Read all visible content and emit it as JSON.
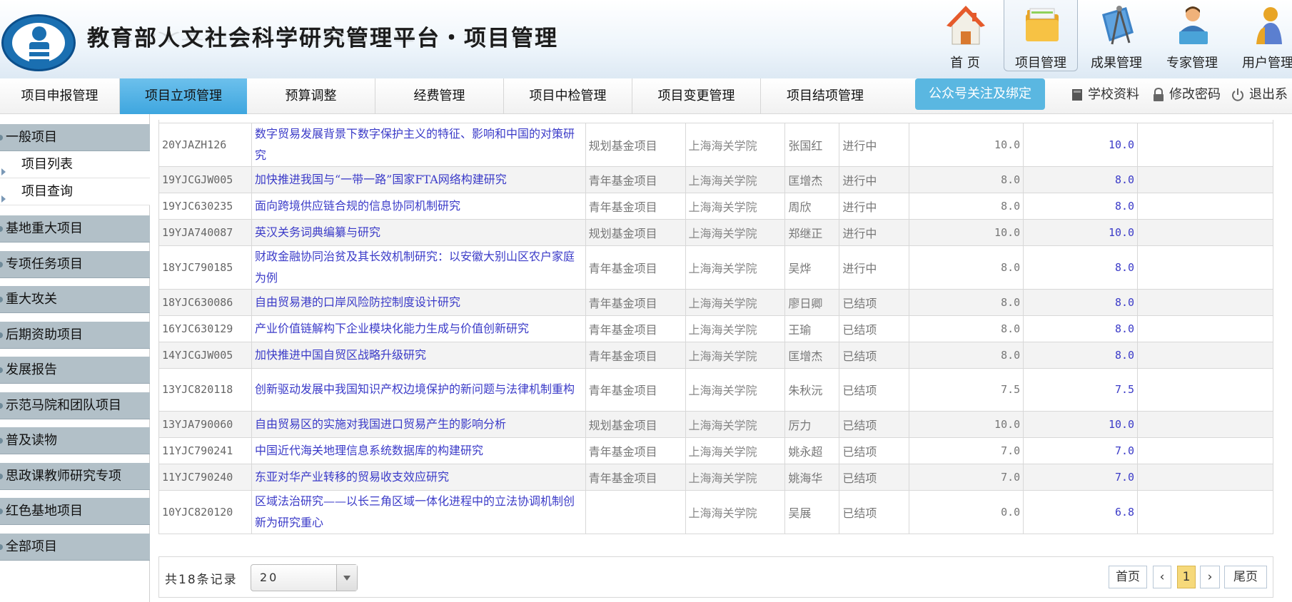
{
  "header": {
    "title": "教育部人文社会科学研究管理平台・项目管理",
    "top_nav": [
      {
        "label": "首 页",
        "icon": "home-icon"
      },
      {
        "label": "项目管理",
        "icon": "folder-icon"
      },
      {
        "label": "成果管理",
        "icon": "compass-icon"
      },
      {
        "label": "专家管理",
        "icon": "expert-icon"
      },
      {
        "label": "用户管理",
        "icon": "user-icon"
      }
    ]
  },
  "menu": {
    "items": [
      "项目申报管理",
      "项目立项管理",
      "预算调整",
      "经费管理",
      "项目中检管理",
      "项目变更管理",
      "项目结项管理"
    ],
    "active": "项目立项管理",
    "wechat": "公众号关注及绑定",
    "school_info": "学校资料",
    "change_password": "修改密码",
    "logout": "退出系"
  },
  "sidebar": {
    "general": "一般项目",
    "sub_list": "项目列表",
    "sub_query": "项目查询",
    "groups": [
      "基地重大项目",
      "专项任务项目",
      "重大攻关",
      "后期资助项目",
      "发展报告",
      "示范马院和团队项目",
      "普及读物",
      "思政课教师研究专项",
      "红色基地项目",
      "全部项目"
    ]
  },
  "table": {
    "rows": [
      {
        "code": "20YJAZH126",
        "title": "数字贸易发展背景下数字保护主义的特征、影响和中国的对策研究",
        "type": "规划基金项目",
        "school": "上海海关学院",
        "person": "张国红",
        "status": "进行中",
        "amount1": "10.0",
        "amount2": "10.0"
      },
      {
        "code": "19YJCGJW005",
        "title": "加快推进我国与“一带一路”国家FTA网络构建研究",
        "type": "青年基金项目",
        "school": "上海海关学院",
        "person": "匡增杰",
        "status": "进行中",
        "amount1": "8.0",
        "amount2": "8.0"
      },
      {
        "code": "19YJC630235",
        "title": "面向跨境供应链合规的信息协同机制研究",
        "type": "青年基金项目",
        "school": "上海海关学院",
        "person": "周欣",
        "status": "进行中",
        "amount1": "8.0",
        "amount2": "8.0"
      },
      {
        "code": "19YJA740087",
        "title": "英汉关务词典编纂与研究",
        "type": "规划基金项目",
        "school": "上海海关学院",
        "person": "郑继正",
        "status": "进行中",
        "amount1": "10.0",
        "amount2": "10.0"
      },
      {
        "code": "18YJC790185",
        "title": "财政金融协同治贫及其长效机制研究：以安徽大别山区农户家庭为例",
        "type": "青年基金项目",
        "school": "上海海关学院",
        "person": "吴烨",
        "status": "进行中",
        "amount1": "8.0",
        "amount2": "8.0"
      },
      {
        "code": "18YJC630086",
        "title": "自由贸易港的口岸风险防控制度设计研究",
        "type": "青年基金项目",
        "school": "上海海关学院",
        "person": "廖日卿",
        "status": "已结项",
        "amount1": "8.0",
        "amount2": "8.0"
      },
      {
        "code": "16YJC630129",
        "title": "产业价值链解构下企业模块化能力生成与价值创新研究",
        "type": "青年基金项目",
        "school": "上海海关学院",
        "person": "王瑜",
        "status": "已结项",
        "amount1": "8.0",
        "amount2": "8.0"
      },
      {
        "code": "14YJCGJW005",
        "title": "加快推进中国自贸区战略升级研究",
        "type": "青年基金项目",
        "school": "上海海关学院",
        "person": "匡增杰",
        "status": "已结项",
        "amount1": "8.0",
        "amount2": "8.0"
      },
      {
        "code": "13YJC820118",
        "title": "创新驱动发展中我国知识产权边境保护的新问题与法律机制重构",
        "type": "青年基金项目",
        "school": "上海海关学院",
        "person": "朱秋沅",
        "status": "已结项",
        "amount1": "7.5",
        "amount2": "7.5"
      },
      {
        "code": "13YJA790060",
        "title": "自由贸易区的实施对我国进口贸易产生的影响分析",
        "type": "规划基金项目",
        "school": "上海海关学院",
        "person": "厉力",
        "status": "已结项",
        "amount1": "10.0",
        "amount2": "10.0"
      },
      {
        "code": "11YJC790241",
        "title": "中国近代海关地理信息系统数据库的构建研究",
        "type": "青年基金项目",
        "school": "上海海关学院",
        "person": "姚永超",
        "status": "已结项",
        "amount1": "7.0",
        "amount2": "7.0"
      },
      {
        "code": "11YJC790240",
        "title": "东亚对华产业转移的贸易收支效应研究",
        "type": "青年基金项目",
        "school": "上海海关学院",
        "person": "姚海华",
        "status": "已结项",
        "amount1": "7.0",
        "amount2": "7.0"
      },
      {
        "code": "10YJC820120",
        "title": "区域法治研究——以长三角区域一体化进程中的立法协调机制创新为研究重心",
        "type": "",
        "school": "上海海关学院",
        "person": "吴展",
        "status": "已结项",
        "amount1": "0.0",
        "amount2": "6.8"
      }
    ]
  },
  "pager": {
    "total": "共18条记录",
    "page_size": "20",
    "first": "首页",
    "prev": "‹",
    "current": "1",
    "next": "›",
    "last": "尾页"
  }
}
